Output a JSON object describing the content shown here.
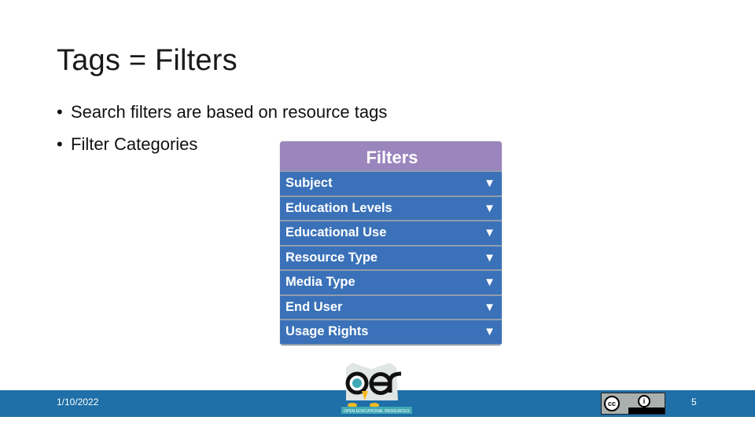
{
  "slide": {
    "title": "Tags = Filters",
    "bullets": [
      "Search filters are based on resource tags",
      "Filter Categories"
    ]
  },
  "filters_panel": {
    "header": "Filters",
    "items": [
      {
        "label": "Subject",
        "icon": "triangle-down-icon",
        "glyph": "▼"
      },
      {
        "label": "Education Levels",
        "icon": "triangle-down-icon",
        "glyph": "▼"
      },
      {
        "label": "Educational Use",
        "icon": "triangle-down-icon",
        "glyph": "▼"
      },
      {
        "label": "Resource Type",
        "icon": "triangle-down-icon",
        "glyph": "▼"
      },
      {
        "label": "Media Type",
        "icon": "triangle-down-icon",
        "glyph": "▼"
      },
      {
        "label": "End User",
        "icon": "triangle-down-icon",
        "glyph": "▼"
      },
      {
        "label": "Usage Rights",
        "icon": "triangle-down-icon",
        "glyph": "▼"
      }
    ],
    "colors": {
      "header": "#9b85bd",
      "row": "#3a71b8"
    }
  },
  "footer": {
    "date": "1/10/2022",
    "page_number": "5",
    "logo_text": "oer",
    "logo_tagline": "OPEN EDUCATIONAL RESOURCES",
    "license_badge": {
      "cc": "cc",
      "by": "i",
      "label": "BY"
    },
    "color": "#1f6fa8"
  }
}
